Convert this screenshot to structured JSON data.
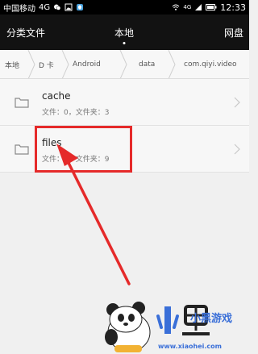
{
  "status_bar": {
    "carrier": "中国移动",
    "network": "4G",
    "signal_network": "4G",
    "time": "12:33",
    "icons": [
      "wechat-icon",
      "image-icon",
      "qq-icon",
      "wifi-icon",
      "signal-icon",
      "battery-icon"
    ]
  },
  "tabs": [
    {
      "label": "分类文件",
      "active": false
    },
    {
      "label": "本地",
      "active": true
    },
    {
      "label": "网盘",
      "active": false
    }
  ],
  "breadcrumb": [
    "本地",
    "D 卡",
    "Android",
    "data",
    "com.qiyi.video"
  ],
  "files": [
    {
      "name": "cache",
      "meta": "文件：0，文件夹：3"
    },
    {
      "name": "files",
      "meta": "文件：0，文件夹：9"
    }
  ],
  "watermark": {
    "logo_text": "小黑游戏",
    "url": "www.xiaohei.com"
  },
  "colors": {
    "highlight": "#e52a2a",
    "tabbar_bg": "#121212",
    "watermark_blue": "#3a6fd8"
  }
}
